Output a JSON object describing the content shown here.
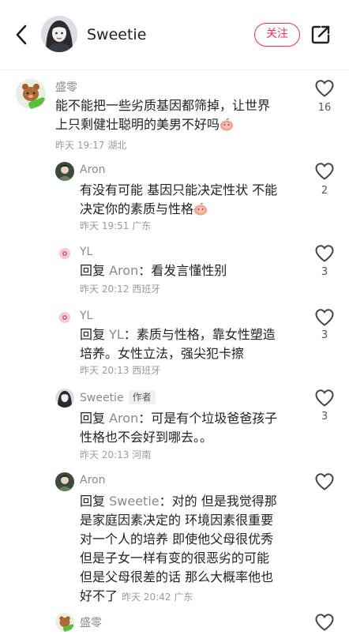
{
  "header": {
    "name": "Sweetie",
    "follow_label": "关注"
  },
  "icons": {
    "back": "chevron-left-icon",
    "share": "share-icon",
    "like": "heart-outline-icon",
    "emoji": "peach-emoji"
  },
  "colors": {
    "accent": "#ff2e4d",
    "meta_text": "#9b9b9b"
  },
  "comments": [
    {
      "name": "盛零",
      "text_line1": "能不能把一些劣质基因都筛掉，让世界",
      "text_line2": "上只剩健壮聪明的美男不好吗",
      "time": "昨天 19:17",
      "location": "湖北",
      "likes": "16"
    },
    {
      "name": "Aron",
      "text_line1": "有没有可能 基因只能决定性状 不能",
      "text_line2": "决定你的素质与性格",
      "time": "昨天 19:51",
      "location": "广东",
      "likes": "2"
    },
    {
      "name": "YL",
      "reply_prefix": "回复",
      "reply_to": "Aron",
      "text": "：看发言懂性别",
      "time": "昨天 20:12",
      "location": "西班牙",
      "likes": "3"
    },
    {
      "name": "YL",
      "reply_prefix": "回复",
      "reply_to": "YL",
      "text_line1": "：素质与性格，靠女性塑造",
      "text_line2": "培养。女性立法，强尖犯卡擦",
      "time": "昨天 20:13",
      "location": "西班牙",
      "likes": "3"
    },
    {
      "name": "Sweetie",
      "author_tag": "作者",
      "reply_prefix": "回复",
      "reply_to": "Aron",
      "text_line1": "：可是有个垃圾爸爸孩子",
      "text_line2": "性格也不会好到哪去。。",
      "time": "昨天 20:13",
      "location": "河南",
      "likes": "3"
    },
    {
      "name": "Aron",
      "reply_prefix": "回复",
      "reply_to": "Sweetie",
      "text_line1": "：对的 但是我觉得那",
      "text_line2": "是家庭因素决定的 环境因素很重要",
      "text_line3": "对一个人的培养 即使他父母很优秀",
      "text_line4": "但是子女一样有变的很恶劣的可能",
      "text_line5": "但是父母很差的话 那么大概率他也",
      "text_line6": "好不了",
      "time": "昨天 20:42",
      "location": "广东"
    },
    {
      "name": "盛零"
    }
  ]
}
